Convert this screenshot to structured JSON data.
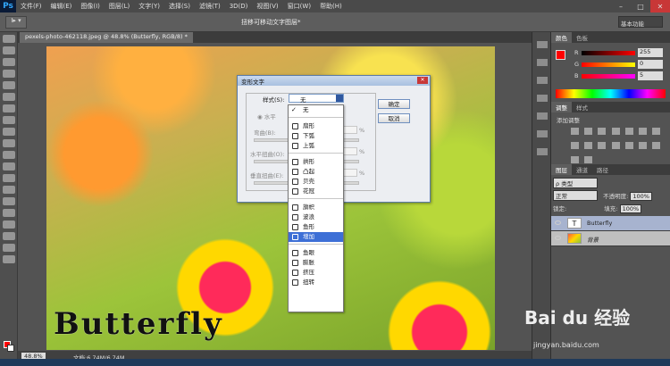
{
  "app": {
    "logo": "Ps",
    "menu": [
      "文件(F)",
      "编辑(E)",
      "图像(I)",
      "图层(L)",
      "文字(Y)",
      "选择(S)",
      "滤镜(T)",
      "3D(D)",
      "视图(V)",
      "窗口(W)",
      "帮助(H)"
    ],
    "window_controls": {
      "minimize": "–",
      "maximize": "□",
      "close": "✕"
    }
  },
  "options_bar": {
    "title": "扭移可移动文字图层*",
    "workspace": "基本功能",
    "tool_label": "I▸ ▾"
  },
  "document": {
    "tab_label": "pexels-photo-462118.jpeg @ 48.8% (Butterfly, RGB/8) *",
    "canvas_text": "Butterfly",
    "zoom": "48.8%",
    "doc_size": "文档:6.74M/6.74M"
  },
  "color_panel": {
    "tabs": [
      "颜色",
      "色板"
    ],
    "channels": [
      {
        "label": "R",
        "value": "255"
      },
      {
        "label": "G",
        "value": "0"
      },
      {
        "label": "B",
        "value": "5"
      },
      {
        "label": "",
        "value": "5"
      }
    ]
  },
  "adjust_panel": {
    "tabs": [
      "调整",
      "样式"
    ],
    "title": "添加调整"
  },
  "layers_panel": {
    "tabs": [
      "图层",
      "通道",
      "路径"
    ],
    "filter": "ρ 类型",
    "blend_mode": "正常",
    "opacity_label": "不透明度:",
    "opacity": "100%",
    "lock_label": "锁定:",
    "fill_label": "填充:",
    "fill": "100%",
    "layers": [
      {
        "name": "Butterfly",
        "selected": true
      },
      {
        "name": "背景",
        "selected": false
      }
    ]
  },
  "warp_dialog": {
    "title": "变形文字",
    "style_label": "样式(S):",
    "style_value": "无",
    "orientation_label": "◉ 水平",
    "bend_label": "弯曲(B):",
    "h_distort_label": "水平扭曲(O):",
    "v_distort_label": "垂直扭曲(E):",
    "percent": "%",
    "ok_label": "确定",
    "cancel_label": "取消"
  },
  "style_dropdown": {
    "checked": "✓",
    "groups": [
      [
        {
          "label": "无",
          "icon": "none"
        }
      ],
      [
        {
          "label": "扇形",
          "icon": "arc-icon"
        },
        {
          "label": "下弧",
          "icon": "arc-lower-icon"
        },
        {
          "label": "上弧",
          "icon": "arc-upper-icon"
        }
      ],
      [
        {
          "label": "拱形",
          "icon": "arch-icon"
        },
        {
          "label": "凸起",
          "icon": "bulge-icon"
        },
        {
          "label": "贝壳",
          "icon": "shell-icon"
        },
        {
          "label": "花冠",
          "icon": "flag-icon"
        }
      ],
      [
        {
          "label": "旗帜",
          "icon": "wave-flag-icon"
        },
        {
          "label": "波浪",
          "icon": "wave-icon"
        },
        {
          "label": "鱼形",
          "icon": "fish-icon"
        },
        {
          "label": "增加",
          "icon": "rise-icon",
          "selected": true
        }
      ],
      [
        {
          "label": "鱼眼",
          "icon": "fisheye-icon"
        },
        {
          "label": "膨胀",
          "icon": "inflate-icon"
        },
        {
          "label": "挤压",
          "icon": "squeeze-icon"
        },
        {
          "label": "扭转",
          "icon": "twist-icon"
        }
      ]
    ]
  },
  "watermark": {
    "brand": "Bai du 经验",
    "url": "jingyan.baidu.com"
  },
  "colors": {
    "foreground": "#ff0000",
    "selection": "#3d6fd6"
  }
}
